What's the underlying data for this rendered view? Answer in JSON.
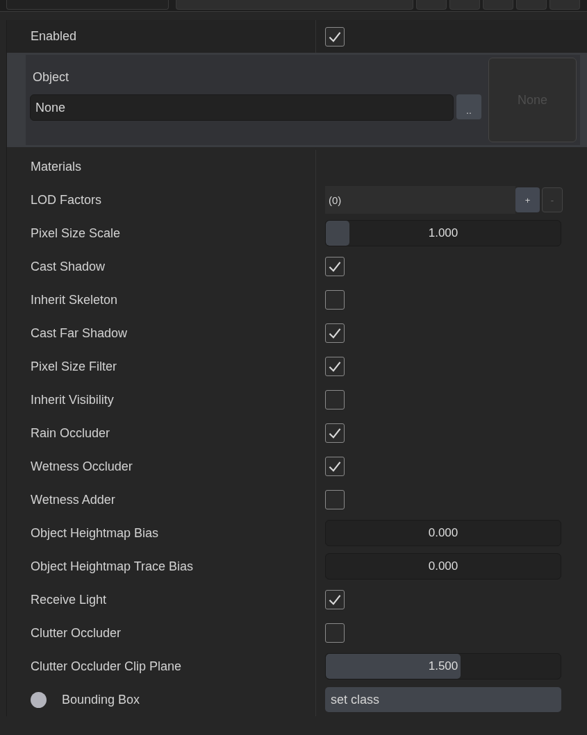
{
  "enabled": {
    "label": "Enabled",
    "checked": true
  },
  "object": {
    "label": "Object",
    "value": "None",
    "browse": "..",
    "preview": "None"
  },
  "properties": [
    {
      "kind": "label",
      "label": "Materials"
    },
    {
      "kind": "list",
      "label": "LOD Factors",
      "value": "(0)",
      "add": "+",
      "remove": "-"
    },
    {
      "kind": "slider",
      "label": "Pixel Size Scale",
      "value": "1.000",
      "level": 0.1
    },
    {
      "kind": "checkbox",
      "label": "Cast Shadow",
      "checked": true
    },
    {
      "kind": "checkbox",
      "label": "Inherit Skeleton",
      "checked": false
    },
    {
      "kind": "checkbox",
      "label": "Cast Far Shadow",
      "checked": true
    },
    {
      "kind": "checkbox",
      "label": "Pixel Size Filter",
      "checked": true
    },
    {
      "kind": "checkbox",
      "label": "Inherit Visibility",
      "checked": false
    },
    {
      "kind": "checkbox",
      "label": "Rain Occluder",
      "checked": true
    },
    {
      "kind": "checkbox",
      "label": "Wetness Occluder",
      "checked": true
    },
    {
      "kind": "checkbox",
      "label": "Wetness Adder",
      "checked": false
    },
    {
      "kind": "slider",
      "label": "Object Heightmap Bias",
      "value": "0.000"
    },
    {
      "kind": "slider",
      "label": "Object Heightmap Trace Bias",
      "value": "0.000"
    },
    {
      "kind": "checkbox",
      "label": "Receive Light",
      "checked": true
    },
    {
      "kind": "checkbox",
      "label": "Clutter Occluder",
      "checked": false
    },
    {
      "kind": "slider",
      "label": "Clutter Occluder Clip Plane",
      "value": "1.500",
      "level": 0.575
    },
    {
      "kind": "text",
      "label": "Bounding Box",
      "value": "set class",
      "dot": true
    }
  ]
}
